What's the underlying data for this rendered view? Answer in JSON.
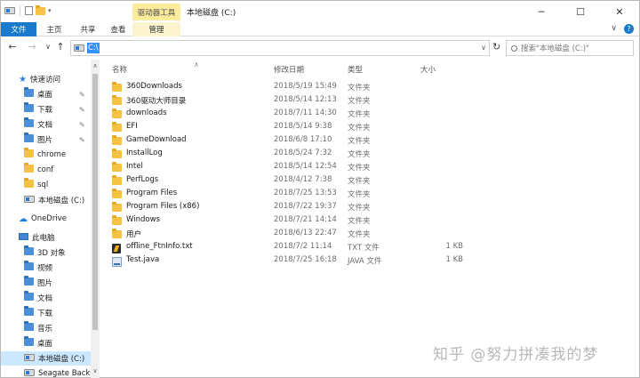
{
  "titlebar": {
    "context_tab": "驱动器工具",
    "title": "本地磁盘 (C:)",
    "minimize": "─",
    "maximize": "☐",
    "close": "✕"
  },
  "ribbon": {
    "tabs": [
      {
        "label": "文件"
      },
      {
        "label": "主页"
      },
      {
        "label": "共享"
      },
      {
        "label": "查看"
      },
      {
        "label": "管理"
      }
    ],
    "collapse": "∨",
    "help": "?"
  },
  "address": {
    "path": "C:\\",
    "dropdown": "∨",
    "search_placeholder": "搜索\"本地磁盘 (C:)\""
  },
  "nav": {
    "items": [
      {
        "label": "快速访问",
        "icon": "star-icon",
        "indent": 0,
        "pinned": false
      },
      {
        "label": "桌面",
        "icon": "folder-blue-icon",
        "indent": 1,
        "pinned": true
      },
      {
        "label": "下载",
        "icon": "download-folder-icon",
        "indent": 1,
        "pinned": true
      },
      {
        "label": "文档",
        "icon": "document-folder-icon",
        "indent": 1,
        "pinned": true
      },
      {
        "label": "图片",
        "icon": "picture-folder-icon",
        "indent": 1,
        "pinned": true
      },
      {
        "label": "chrome",
        "icon": "folder-icon",
        "indent": 1,
        "pinned": false
      },
      {
        "label": "conf",
        "icon": "folder-icon",
        "indent": 1,
        "pinned": false
      },
      {
        "label": "sql",
        "icon": "folder-icon",
        "indent": 1,
        "pinned": false
      },
      {
        "label": "本地磁盘 (C:)",
        "icon": "drive-icon",
        "indent": 1,
        "pinned": false
      },
      {
        "label": "OneDrive",
        "icon": "cloud-icon",
        "indent": 0,
        "pinned": false
      },
      {
        "label": "此电脑",
        "icon": "pc-icon",
        "indent": 0,
        "pinned": false
      },
      {
        "label": "3D 对象",
        "icon": "3d-objects-icon",
        "indent": 1,
        "pinned": false
      },
      {
        "label": "视频",
        "icon": "video-folder-icon",
        "indent": 1,
        "pinned": false
      },
      {
        "label": "图片",
        "icon": "picture-folder-icon",
        "indent": 1,
        "pinned": false
      },
      {
        "label": "文档",
        "icon": "document-folder-icon",
        "indent": 1,
        "pinned": false
      },
      {
        "label": "下载",
        "icon": "download-folder-icon",
        "indent": 1,
        "pinned": false
      },
      {
        "label": "音乐",
        "icon": "music-folder-icon",
        "indent": 1,
        "pinned": false
      },
      {
        "label": "桌面",
        "icon": "folder-blue-icon",
        "indent": 1,
        "pinned": false
      },
      {
        "label": "本地磁盘 (C:)",
        "icon": "drive-icon",
        "indent": 1,
        "pinned": false,
        "selected": true
      },
      {
        "label": "Seagate Backup",
        "icon": "drive-icon",
        "indent": 1,
        "pinned": false
      }
    ]
  },
  "columns": {
    "name": "名称",
    "date": "修改日期",
    "type": "类型",
    "size": "大小"
  },
  "files": [
    {
      "name": "360Downloads",
      "date": "2018/5/19 15:49",
      "type": "文件夹",
      "size": "",
      "icon": "folder-icon"
    },
    {
      "name": "360驱动大师目录",
      "date": "2018/5/14 12:13",
      "type": "文件夹",
      "size": "",
      "icon": "folder-icon"
    },
    {
      "name": "downloads",
      "date": "2018/7/11 14:30",
      "type": "文件夹",
      "size": "",
      "icon": "folder-icon"
    },
    {
      "name": "EFI",
      "date": "2018/5/14 9:38",
      "type": "文件夹",
      "size": "",
      "icon": "folder-icon"
    },
    {
      "name": "GameDownload",
      "date": "2018/6/8 17:10",
      "type": "文件夹",
      "size": "",
      "icon": "folder-icon"
    },
    {
      "name": "InstallLog",
      "date": "2018/5/24 7:32",
      "type": "文件夹",
      "size": "",
      "icon": "folder-icon"
    },
    {
      "name": "Intel",
      "date": "2018/5/14 12:54",
      "type": "文件夹",
      "size": "",
      "icon": "folder-icon"
    },
    {
      "name": "PerfLogs",
      "date": "2018/4/12 7:38",
      "type": "文件夹",
      "size": "",
      "icon": "folder-icon"
    },
    {
      "name": "Program Files",
      "date": "2018/7/25 13:53",
      "type": "文件夹",
      "size": "",
      "icon": "folder-icon"
    },
    {
      "name": "Program Files (x86)",
      "date": "2018/7/22 19:37",
      "type": "文件夹",
      "size": "",
      "icon": "folder-icon"
    },
    {
      "name": "Windows",
      "date": "2018/7/21 14:14",
      "type": "文件夹",
      "size": "",
      "icon": "folder-icon"
    },
    {
      "name": "用户",
      "date": "2018/6/13 22:47",
      "type": "文件夹",
      "size": "",
      "icon": "folder-icon"
    },
    {
      "name": "offline_FtnInfo.txt",
      "date": "2018/7/2 11:14",
      "type": "TXT 文件",
      "size": "1 KB",
      "icon": "text-file-icon"
    },
    {
      "name": "Test.java",
      "date": "2018/7/25 16:18",
      "type": "JAVA 文件",
      "size": "1 KB",
      "icon": "java-file-icon"
    }
  ],
  "watermark": "知乎 @努力拼凑我的梦",
  "colors": {
    "accent": "#1979ca",
    "context_tab": "#fbeb9b",
    "selection": "#cce8ff",
    "folder": "#f5c243"
  }
}
